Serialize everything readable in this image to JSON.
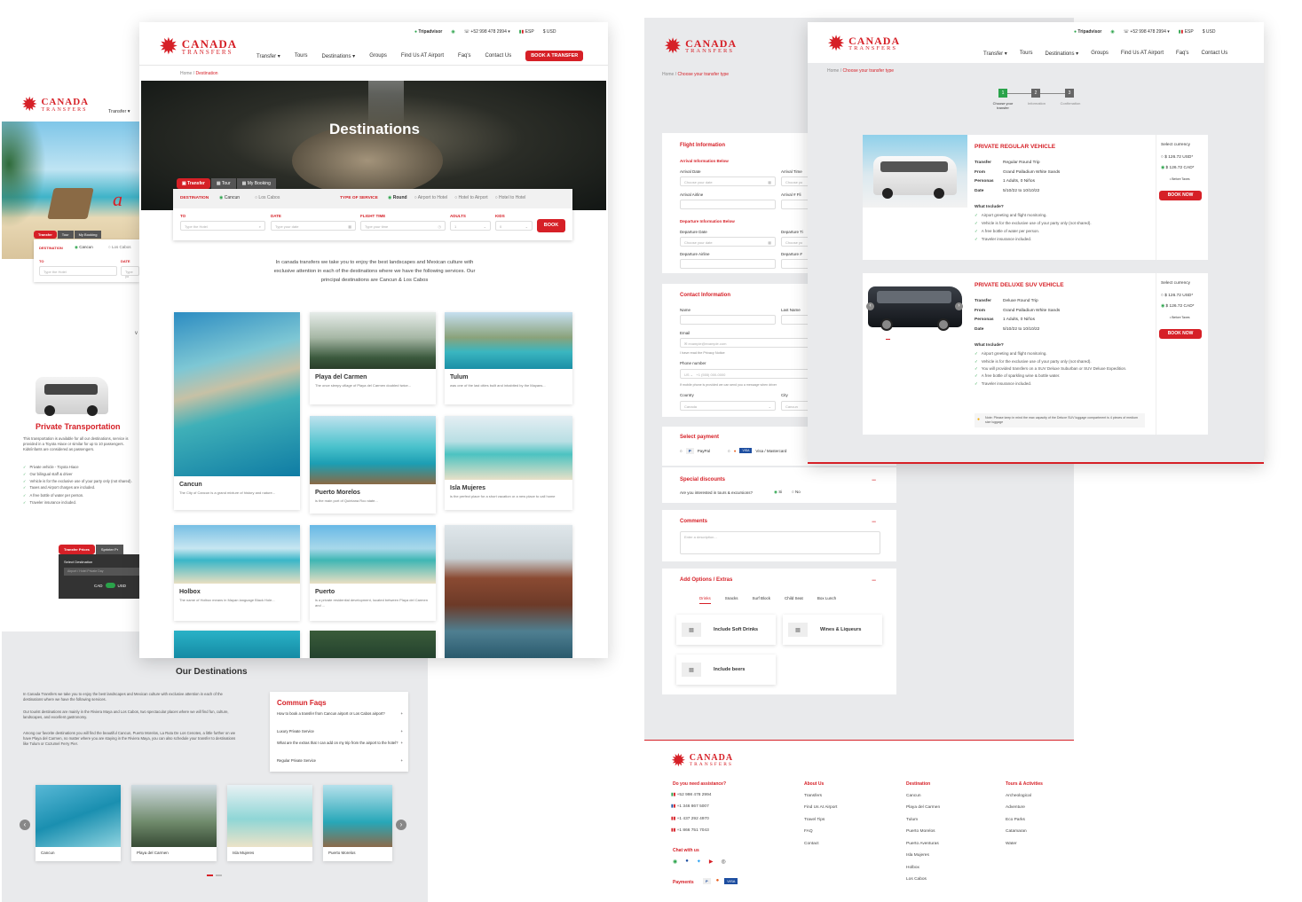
{
  "brand": {
    "name_top": "CANADA",
    "name_bottom": "TRANSFERS"
  },
  "topbar": {
    "tripadvisor": "Tripadvisor",
    "phone": "+52 998 478 2994",
    "lang": "ESP",
    "currency": "$ USD"
  },
  "nav": {
    "items": [
      "Transfer",
      "Tours",
      "Destinations",
      "Groups",
      "Find Us AT Airport",
      "Faq's",
      "Contact Us"
    ],
    "book": "BOOK A TRANSFER"
  },
  "breadcrumb_dest": {
    "home": "Home",
    "sep": "/",
    "current": "Destination"
  },
  "breadcrumb_transfer": {
    "home": "Home",
    "sep": "/",
    "current": "Choose your transfer type"
  },
  "hero": {
    "title": "Destinations"
  },
  "booking": {
    "tabs": [
      "Transfer",
      "Tour",
      "My Booking"
    ],
    "destination_label": "DESTINATION",
    "dest_options": [
      "Cancun",
      "Los Cabos"
    ],
    "service_label": "TYPE OF SERVICE",
    "service_options": [
      "Round",
      "Airport to Hotel",
      "Hotel to Airport",
      "Hotel to Hotel"
    ],
    "fields": [
      {
        "label": "TO",
        "placeholder": "Type the Hotel"
      },
      {
        "label": "DATE",
        "placeholder": "Type your date"
      },
      {
        "label": "FLIGHT TIME",
        "placeholder": "Type your time"
      },
      {
        "label": "ADULTS",
        "placeholder": "1"
      },
      {
        "label": "KIDS",
        "placeholder": "0"
      }
    ],
    "book": "BOOK"
  },
  "intro": {
    "text": "In canada transfers we take you to enjoy the best landscapes and Mexican culture with exclusive attention in each of the destinations where we have the following services.  Our principal destinations are Cancun & Los Cabos"
  },
  "destinations": [
    {
      "name": "Cancun",
      "desc": "The City of Cancun is a grand mixture of history and nature..."
    },
    {
      "name": "Playa del Carmen",
      "desc": "The once sleepy village of Playa del Carmen doubled twice..."
    },
    {
      "name": "Tulum",
      "desc": "was one of the last cities built and inhabited by the Mayans..."
    },
    {
      "name": "Puerto Morelos",
      "desc": "is the main port of Quintana Roo state..."
    },
    {
      "name": "Isla Mujeres",
      "desc": "is the perfect place for a short vacation or a new place to call home"
    },
    {
      "name": "Holbox",
      "desc": "The name of Holbox means in Mayan language Black Hole..."
    },
    {
      "name": "Puerto",
      "desc": "is a private residential development, located between Playa del Carmen and ..."
    }
  ],
  "mobile": {
    "nav": "Transfer",
    "tabs": [
      "Transfer",
      "Tour",
      "My Booking"
    ],
    "dest_label": "DESTINATION",
    "dest_options": [
      "Cancun",
      "Los Cabos"
    ],
    "to_label": "TO",
    "date_label": "DATE",
    "to_placeholder": "Type the Hotel",
    "date_placeholder": "Type yo",
    "vehicle_title": "Private Transportation",
    "vehicle_desc": "This transportation is available for all our destinations, service is provided in a Toyota Hiace or similar for up to 10 passengers. Kids/infants are considered as passengers.",
    "features": [
      "Private vehicle - Toyota Hiace",
      "Our bilingual staff & driver",
      "Vehicle is for the exclusive use of your party only (not shared).",
      "Taxes and Airport charges are included.",
      "A free bottle of water per person.",
      "Traveler insurance included."
    ],
    "price_tabs": [
      "Transfer Prices",
      "Sprinter Pr"
    ],
    "select_label": "Select Destination",
    "select_placeholder": "Airport / Hotel Private Day",
    "toggle_left": "CAD",
    "toggle_right": "USD"
  },
  "our_destinations": {
    "title": "Our Destinations",
    "p1": "In Canada Transfers we take you to enjoy the best landscapes and Mexican culture with exclusive attention in each of the destinations where we have the following services.",
    "p2": "Our tourist destinations are mainly in the Riviera Maya and Los Cabos, two spectacular places where we will find fun, culture, landscapes, and excellent gastronomy.",
    "p3": "Among our favorite destinations you will find the beautiful Cancun, Puerto Morelos, La Ruta De Los Cenotes, a little further on we have Playa del Carmen, no matter where you are staying in the Riviera Maya, you can also schedule your transfer to destinations like Tulum or Cozumel Ferry Pier.",
    "carousel": [
      "Cancun",
      "Playa del Carmen",
      "Isla Mujeres",
      "Puerto Morelos"
    ]
  },
  "faqs": {
    "title": "Commun Faqs",
    "items": [
      "How to book a transfer from Cancun airport or Los Cabos airport?",
      "Luxury Private Service",
      "What are the extras that I can add on my trip from the airport to the hotel?",
      "Regular Private Service"
    ]
  },
  "form": {
    "flight_title": "Flight Information",
    "arrival_title": "Arrival Information Below",
    "arrival_date": "Arrival Date",
    "arrival_time": "Arrival Time",
    "arrival_airline": "Arrival Airline",
    "arrival_flight": "Arrival # Fli",
    "date_placeholder": "Choose your date",
    "short_placeholder": "Choose yo",
    "departure_title": "Departure Information Below",
    "departure_date": "Departure Date",
    "departure_time": "Departure Ti",
    "departure_airline": "Departure Airline",
    "departure_flight": "Departure #",
    "contact_title": "Contact Information",
    "name": "Name",
    "last_name": "Last Name",
    "email": "Email",
    "email_placeholder": "example@example.com",
    "privacy": "I have read the Privacy Notice",
    "phone": "Phone number",
    "phone_code": "US",
    "phone_placeholder": "+1 (555) 000-0000",
    "phone_note": "If mobile phone is provided we can send you a message when driver",
    "country": "Country",
    "city": "City",
    "country_placeholder": "Canada",
    "city_placeholder": "Cancun",
    "payment_title": "Select payment",
    "paypal": "PayPal",
    "visa": "Visa / Mastercard",
    "discount_title": "Special discounts",
    "discount_q": "Are you interested in tours & excursions?",
    "yes": "Si",
    "no": "No",
    "comments_title": "Comments",
    "comments_placeholder": "Enter a description...",
    "extras_title": "Add Options / Extras",
    "extra_tabs": [
      "Drinks",
      "Snacks",
      "Surf Block",
      "Child Seat",
      "Box Lunch"
    ],
    "extras": [
      "Include Soft Drinks",
      "Wines & Liqueurs",
      "Include beers"
    ],
    "collapse": "−"
  },
  "steps": [
    "Choose your transfer",
    "Information",
    "Confirmation"
  ],
  "vehicles": [
    {
      "title": "PRIVATE REGULAR VEHICLE",
      "transfer": "Regular Round Trip",
      "from": "Grand Palladium White Sands",
      "persons": "1 Adults, 0 Niños",
      "date": "5/10/22 to 10/10/22",
      "features": [
        "Airport greeting and flight monitoring.",
        "Vehicle is for the exclusive use of your party only (not shared).",
        "A free bottle of water per person.",
        "Traveler insurance included."
      ]
    },
    {
      "title": "PRIVATE DELUXE SUV VEHICLE",
      "transfer": "Deluxe Round Trip",
      "from": "Grand Palladium White Sands",
      "persons": "1 Adults, 0 Niños",
      "date": "5/10/22 to 10/10/22",
      "features": [
        "Airport greeting and flight monitoring.",
        "Vehicle is for the exclusive use of your party only (not shared).",
        "You will provided transfers on a SUV Deluxe Suburban or SUV Deluxe Expedition.",
        "A free bottle of sparkling wine & bottle water.",
        "Traveler insurance included."
      ],
      "note": "Note: Please keep in mind the max capacity of the Deluxe SUV luggage compartment is 4 pieces of medium size luggage"
    }
  ],
  "vehicle_labels": {
    "transfer": "Transfer",
    "from": "From",
    "persons": "Personas",
    "date": "Date",
    "include": "What Include?",
    "currency": "Select currency",
    "usd": "$ 126.72 USD*",
    "cad": "$ 126.72 CAD*",
    "before_taxes": "• Before Taxes",
    "book": "BOOK NOW"
  },
  "footer": {
    "help_title": "Do you need assistance?",
    "phones": [
      "+52 998 478 2994",
      "+1 346 867 5007",
      "+1 437 292 4970",
      "+1 866 751 7043"
    ],
    "chat": "Chat with us",
    "payments": "Payments",
    "about_title": "About Us",
    "about": [
      "Transfers",
      "Find Us At Airport",
      "Travel Tips",
      "FAQ",
      "Contact"
    ],
    "dest_title": "Destination",
    "dest": [
      "Cancun",
      "Playa del Carmen",
      "Tulum",
      "Puerto Morelos",
      "Puerto Aventuras",
      "Isla Mujeres",
      "Holbox",
      "Los Cabos"
    ],
    "tours_title": "Tours & Activities",
    "tours": [
      "Archeological",
      "Adventure",
      "Eco Parks",
      "Catamaran",
      "Water"
    ]
  }
}
